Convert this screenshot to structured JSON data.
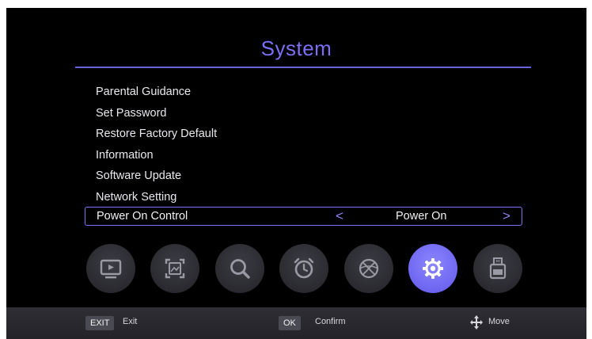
{
  "title": "System",
  "menu": [
    "Parental Guidance",
    "Set Password",
    "Restore Factory Default",
    "Information",
    "Software Update",
    "Network Setting"
  ],
  "selected": {
    "label": "Power On Control",
    "left_arrow": "<",
    "value": "Power On",
    "right_arrow": ">"
  },
  "icons": [
    {
      "name": "tv-icon",
      "active": false
    },
    {
      "name": "picture-icon",
      "active": false
    },
    {
      "name": "search-icon",
      "active": false
    },
    {
      "name": "alarm-clock-icon",
      "active": false
    },
    {
      "name": "globe-icon",
      "active": false
    },
    {
      "name": "gear-icon",
      "active": true
    },
    {
      "name": "usb-icon",
      "active": false
    }
  ],
  "footer": {
    "exit_key": "EXIT",
    "exit_label": "Exit",
    "ok_key": "OK",
    "ok_label": "Confirm",
    "move_label": "Move"
  },
  "colors": {
    "accent": "#7b6ff2",
    "active_icon": "#6e66f0",
    "background": "#000000"
  }
}
